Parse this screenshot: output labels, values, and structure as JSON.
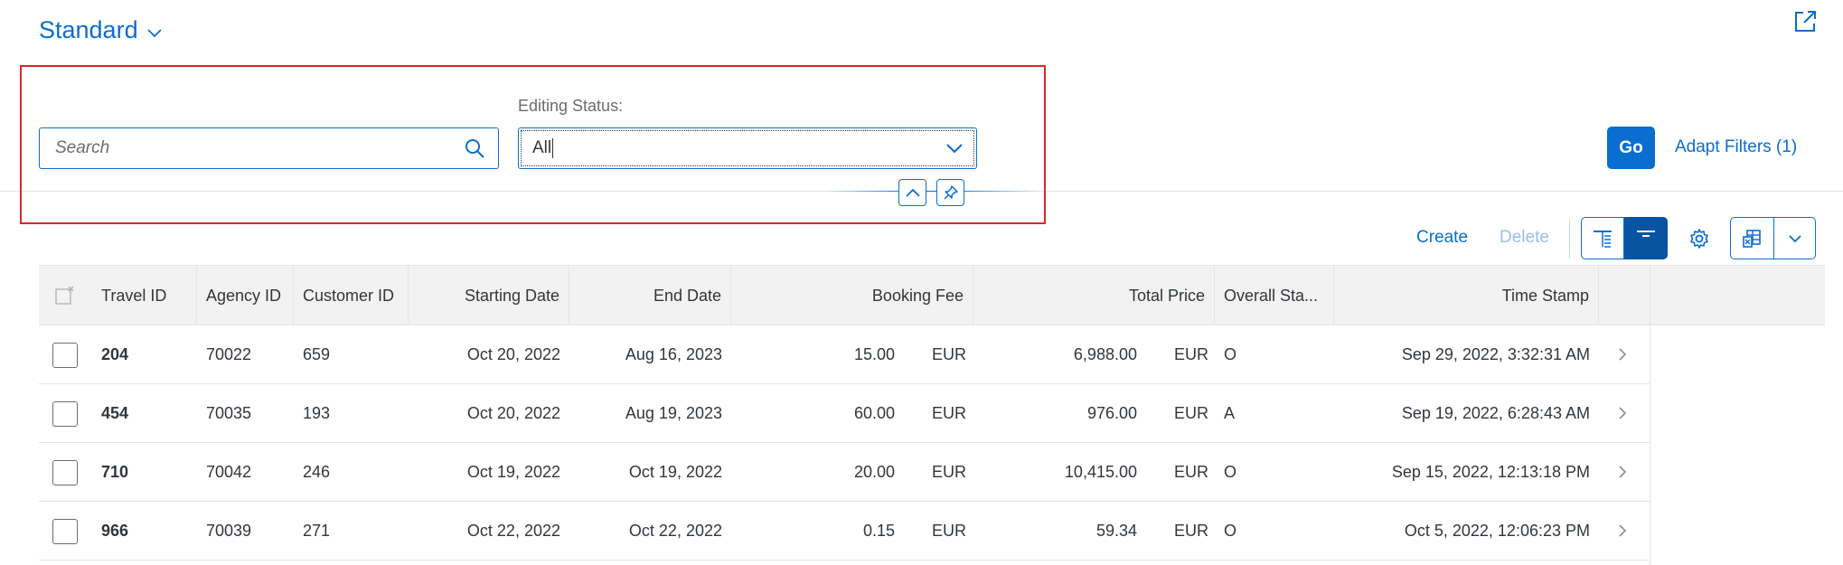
{
  "header": {
    "variant_title": "Standard",
    "filter_bar": {
      "search": {
        "placeholder": "Search",
        "value": ""
      },
      "editing_status": {
        "label": "Editing Status:",
        "value": "All"
      },
      "go_label": "Go",
      "adapt_filters_label": "Adapt Filters (1)"
    }
  },
  "toolbar": {
    "create_label": "Create",
    "delete_label": "Delete"
  },
  "table": {
    "columns": [
      "Travel ID",
      "Agency ID",
      "Customer ID",
      "Starting Date",
      "End Date",
      "Booking Fee",
      "Total Price",
      "Overall Sta...",
      "Time Stamp"
    ],
    "rows": [
      {
        "travel_id": "204",
        "agency_id": "70022",
        "customer_id": "659",
        "starting_date": "Oct 20, 2022",
        "end_date": "Aug 16, 2023",
        "booking_fee": "15.00",
        "booking_fee_currency": "EUR",
        "total_price": "6,988.00",
        "total_price_currency": "EUR",
        "overall_status": "O",
        "time_stamp": "Sep 29, 2022, 3:32:31 AM"
      },
      {
        "travel_id": "454",
        "agency_id": "70035",
        "customer_id": "193",
        "starting_date": "Oct 20, 2022",
        "end_date": "Aug 19, 2023",
        "booking_fee": "60.00",
        "booking_fee_currency": "EUR",
        "total_price": "976.00",
        "total_price_currency": "EUR",
        "overall_status": "A",
        "time_stamp": "Sep 19, 2022, 6:28:43 AM"
      },
      {
        "travel_id": "710",
        "agency_id": "70042",
        "customer_id": "246",
        "starting_date": "Oct 19, 2022",
        "end_date": "Oct 19, 2022",
        "booking_fee": "20.00",
        "booking_fee_currency": "EUR",
        "total_price": "10,415.00",
        "total_price_currency": "EUR",
        "overall_status": "O",
        "time_stamp": "Sep 15, 2022, 12:13:18 PM"
      },
      {
        "travel_id": "966",
        "agency_id": "70039",
        "customer_id": "271",
        "starting_date": "Oct 22, 2022",
        "end_date": "Oct 22, 2022",
        "booking_fee": "0.15",
        "booking_fee_currency": "EUR",
        "total_price": "59.34",
        "total_price_currency": "EUR",
        "overall_status": "O",
        "time_stamp": "Oct 5, 2022, 12:06:23 PM"
      }
    ]
  },
  "colors": {
    "accent": "#0a6ed1",
    "accent_dark": "#0854a0",
    "highlight_border": "#e0242b",
    "text": "#32363a",
    "header_bg": "#f2f2f2"
  },
  "icons": [
    "chevron-down-icon",
    "share-icon",
    "search-icon",
    "collapse-up-icon",
    "pin-icon",
    "table-view-icon",
    "chart-view-icon",
    "settings-icon",
    "export-icon",
    "select-all-icon",
    "row-nav-chevron-icon"
  ]
}
